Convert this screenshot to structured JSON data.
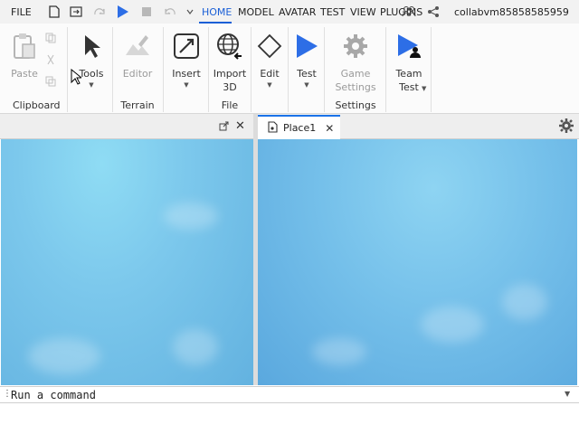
{
  "topbar": {
    "file_label": "FILE",
    "tabs": [
      {
        "label": "HOME",
        "active": true
      },
      {
        "label": "MODEL"
      },
      {
        "label": "AVATAR"
      },
      {
        "label": "TEST"
      },
      {
        "label": "VIEW"
      },
      {
        "label": "PLUGINS"
      }
    ],
    "username": "collabvm85858585959",
    "quick_access_icons": [
      "new-file-icon",
      "open-file-icon",
      "redo-icon",
      "play-icon",
      "stop-icon",
      "undo-icon",
      "chevron-down-icon"
    ],
    "right_icons": [
      "collaborators-icon",
      "share-icon"
    ]
  },
  "ribbon": {
    "buttons": {
      "paste": "Paste",
      "tools": "Tools",
      "editor": "Editor",
      "insert": "Insert",
      "import3d": "Import\n3D",
      "edit": "Edit",
      "test": "Test",
      "game_settings": "Game\nSettings",
      "team_test": "Team\nTest"
    },
    "groups": {
      "clipboard": "Clipboard",
      "terrain": "Terrain",
      "file": "File",
      "settings": "Settings"
    }
  },
  "left_panel": {
    "icons": [
      "popout-icon",
      "close-icon"
    ]
  },
  "document_tab": {
    "label": "Place1"
  },
  "command_bar": {
    "placeholder": "Run a command"
  },
  "colors": {
    "accent": "#1a5fd6",
    "play_blue": "#2d6ee6",
    "sky": "#74c4ea"
  }
}
